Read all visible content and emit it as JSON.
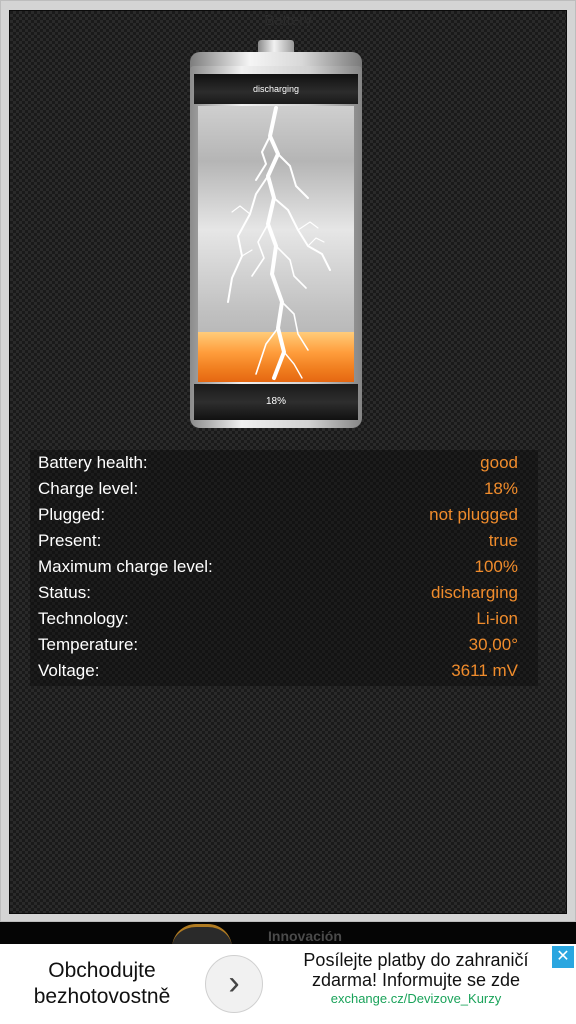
{
  "app": {
    "title": "Battery"
  },
  "battery": {
    "status_label": "discharging",
    "percent_label": "18%",
    "level_fraction": 0.18
  },
  "info": {
    "rows": [
      {
        "label": "Battery health:",
        "value": "good"
      },
      {
        "label": "Charge level:",
        "value": "18%"
      },
      {
        "label": "Plugged:",
        "value": "not plugged"
      },
      {
        "label": "Present:",
        "value": "true"
      },
      {
        "label": "Maximum charge level:",
        "value": "100%"
      },
      {
        "label": "Status:",
        "value": "discharging"
      },
      {
        "label": "Technology:",
        "value": "Li-ion"
      },
      {
        "label": "Temperature:",
        "value": "30,00°"
      },
      {
        "label": "Voltage:",
        "value": "3611 mV"
      }
    ]
  },
  "ad": {
    "partial_text": "Innovación",
    "left_line1": "Obchodujte",
    "left_line2": "bezhotovostně",
    "right_line1": "Posílejte platby do zahraničí",
    "right_line2": "zdarma! Informujte se zde",
    "url": "exchange.cz/Devizove_Kurzy",
    "arrow_glyph": "›",
    "close_glyph": "✕"
  },
  "colors": {
    "value_orange": "#f08c2c",
    "ad_url_green": "#1aa35a",
    "ad_close_blue": "#2aa6e0"
  },
  "icons": [
    "lightning-bolt-icon",
    "chevron-right-icon",
    "close-icon"
  ]
}
